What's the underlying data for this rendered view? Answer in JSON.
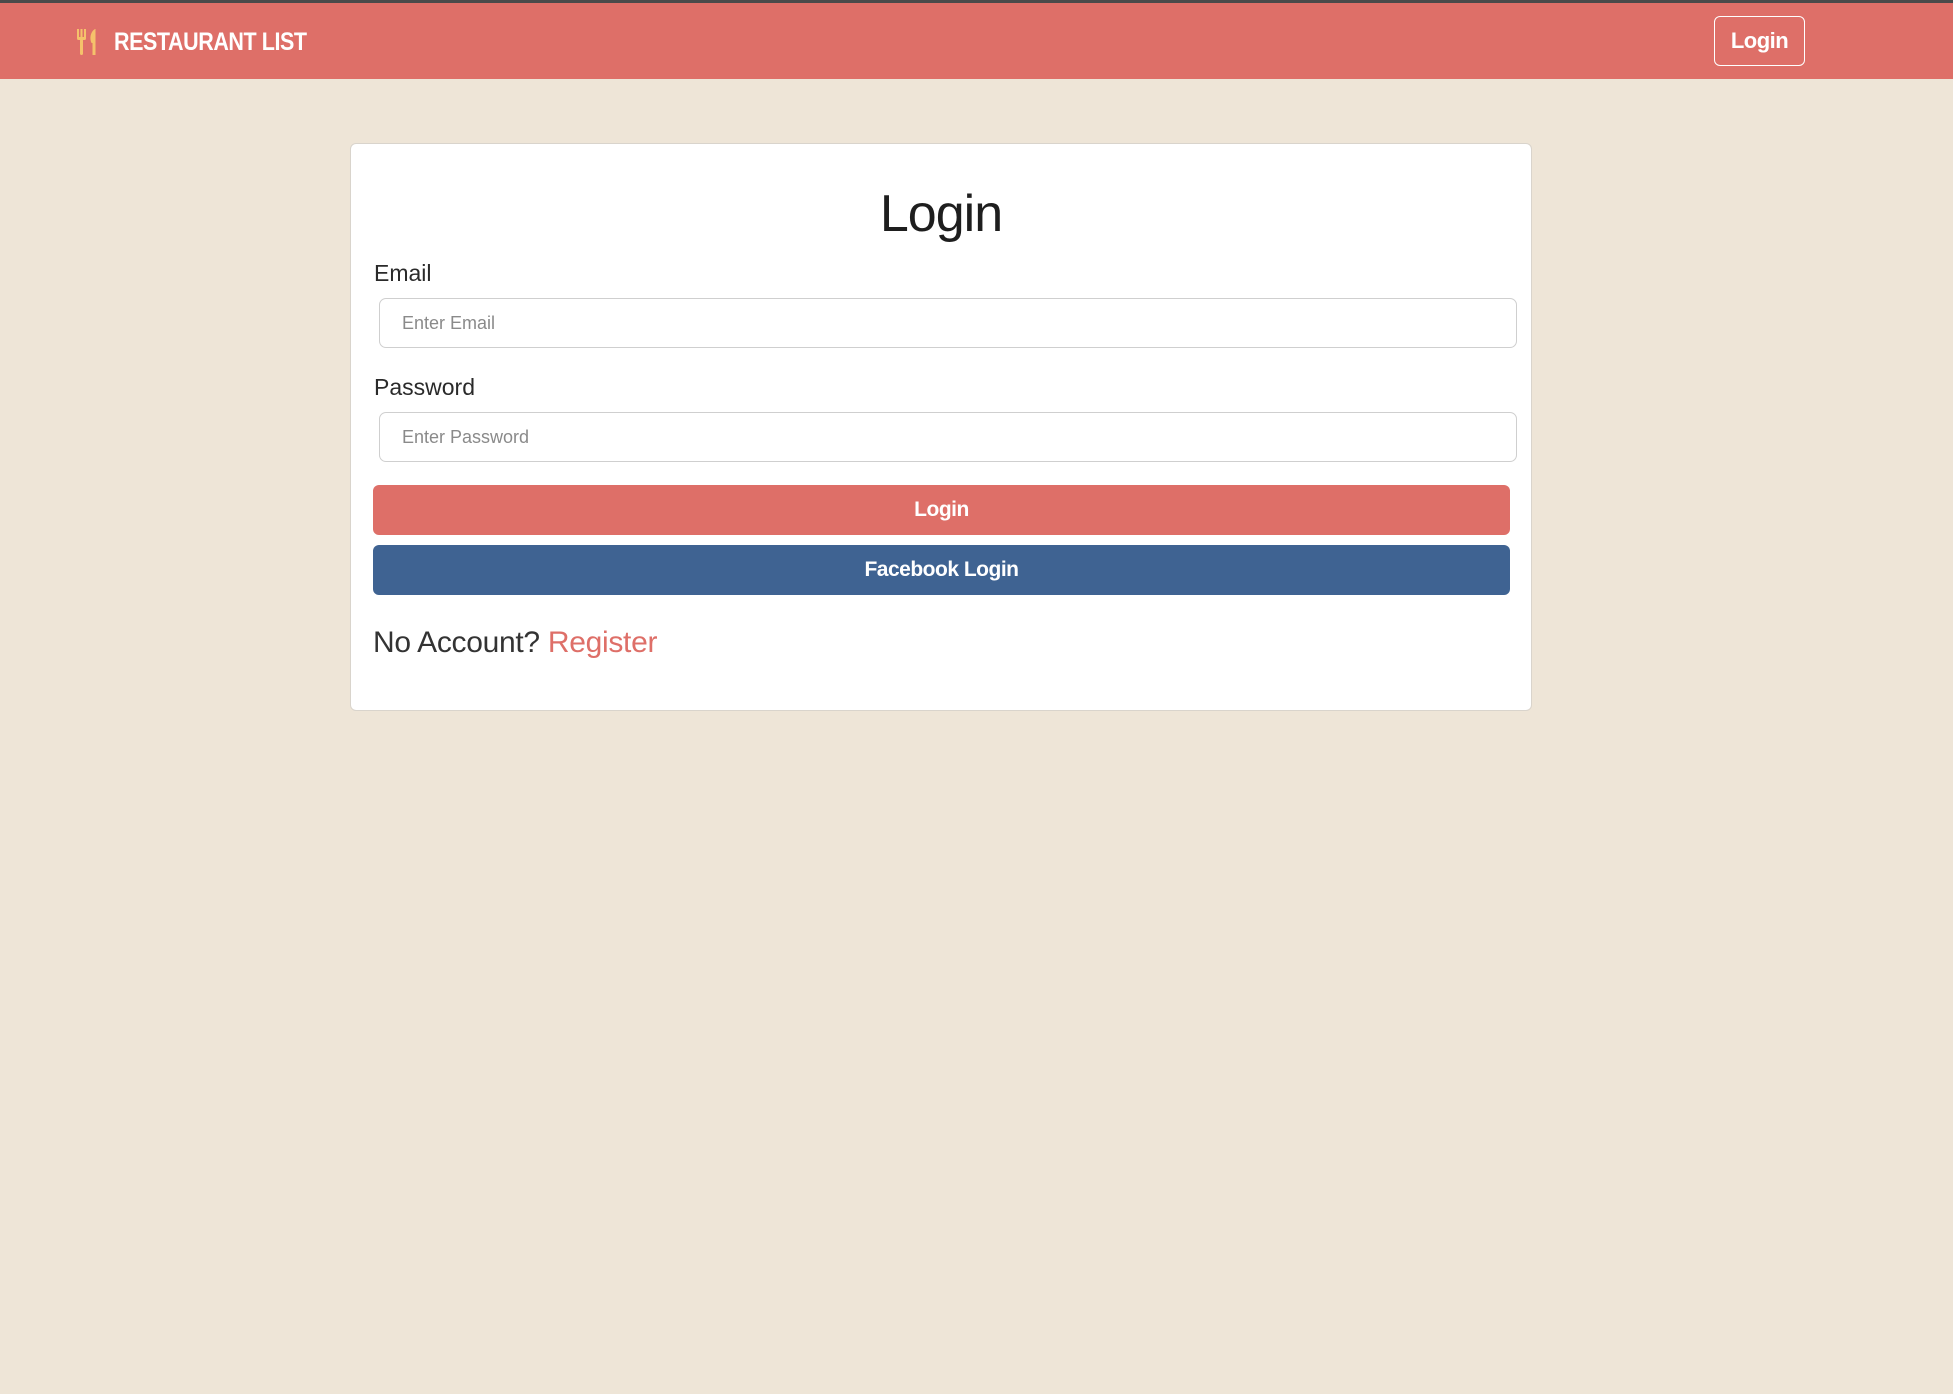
{
  "colors": {
    "navbar_bg": "#DE6F68",
    "page_bg": "#EEE5D7",
    "login_button": "#DE6F68",
    "facebook_button": "#3F6392",
    "brand_icon": "#F5C26B",
    "link": "#DE6F68"
  },
  "navbar": {
    "brand_icon": "utensils-icon",
    "brand_text": "RESTAURANT LIST",
    "login_label": "Login"
  },
  "login_form": {
    "title": "Login",
    "email_label": "Email",
    "email_placeholder": "Enter Email",
    "email_value": "",
    "password_label": "Password",
    "password_placeholder": "Enter Password",
    "password_value": "",
    "submit_label": "Login",
    "facebook_label": "Facebook Login",
    "no_account_text": "No Account?",
    "register_link": "Register"
  }
}
